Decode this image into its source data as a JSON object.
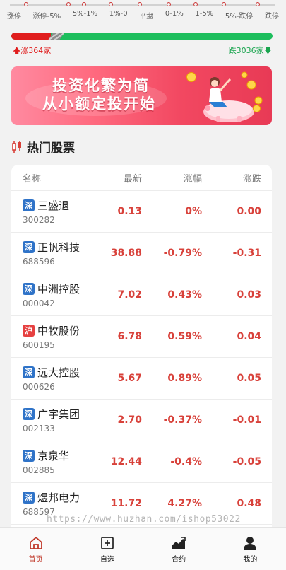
{
  "distribution": {
    "labels": [
      "涨停",
      "涨停-5%",
      "5%-1%",
      "1%-0",
      "平盘",
      "0-1%",
      "1-5%",
      "5%-跌停",
      "跌停"
    ],
    "up_label": "涨364家",
    "down_label": "跌3036家",
    "up_color": "#e01d1d",
    "down_color": "#1dbe5d"
  },
  "banner": {
    "line1": "投资化繁为简",
    "line2": "从小额定投开始"
  },
  "hot": {
    "title": "热门股票",
    "headers": {
      "name": "名称",
      "price": "最新",
      "pct": "涨幅",
      "chg": "涨跌"
    },
    "rows": [
      {
        "market": "深",
        "name": "三盛退",
        "code": "300282",
        "price": "0.13",
        "pct": "0%",
        "chg": "0.00"
      },
      {
        "market": "深",
        "name": "正帆科技",
        "code": "688596",
        "price": "38.88",
        "pct": "-0.79%",
        "chg": "-0.31"
      },
      {
        "market": "深",
        "name": "中洲控股",
        "code": "000042",
        "price": "7.02",
        "pct": "0.43%",
        "chg": "0.03"
      },
      {
        "market": "沪",
        "name": "中牧股份",
        "code": "600195",
        "price": "6.78",
        "pct": "0.59%",
        "chg": "0.04"
      },
      {
        "market": "深",
        "name": "远大控股",
        "code": "000626",
        "price": "5.67",
        "pct": "0.89%",
        "chg": "0.05"
      },
      {
        "market": "深",
        "name": "广宇集团",
        "code": "002133",
        "price": "2.70",
        "pct": "-0.37%",
        "chg": "-0.01"
      },
      {
        "market": "深",
        "name": "京泉华",
        "code": "002885",
        "price": "12.44",
        "pct": "-0.4%",
        "chg": "-0.05"
      },
      {
        "market": "深",
        "name": "煜邦电力",
        "code": "688597",
        "price": "11.72",
        "pct": "4.27%",
        "chg": "0.48"
      }
    ]
  },
  "watermark": "https://www.huzhan.com/ishop53022",
  "nav": [
    {
      "label": "首页",
      "icon": "home-icon",
      "active": true
    },
    {
      "label": "自选",
      "icon": "add-watchlist-icon",
      "active": false
    },
    {
      "label": "合约",
      "icon": "chart-trend-icon",
      "active": false
    },
    {
      "label": "我的",
      "icon": "user-icon",
      "active": false
    }
  ],
  "colors": {
    "accent": "#c0392b",
    "price_red": "#d8413a",
    "sz_badge": "#2f73c8",
    "sh_badge": "#e64040"
  }
}
